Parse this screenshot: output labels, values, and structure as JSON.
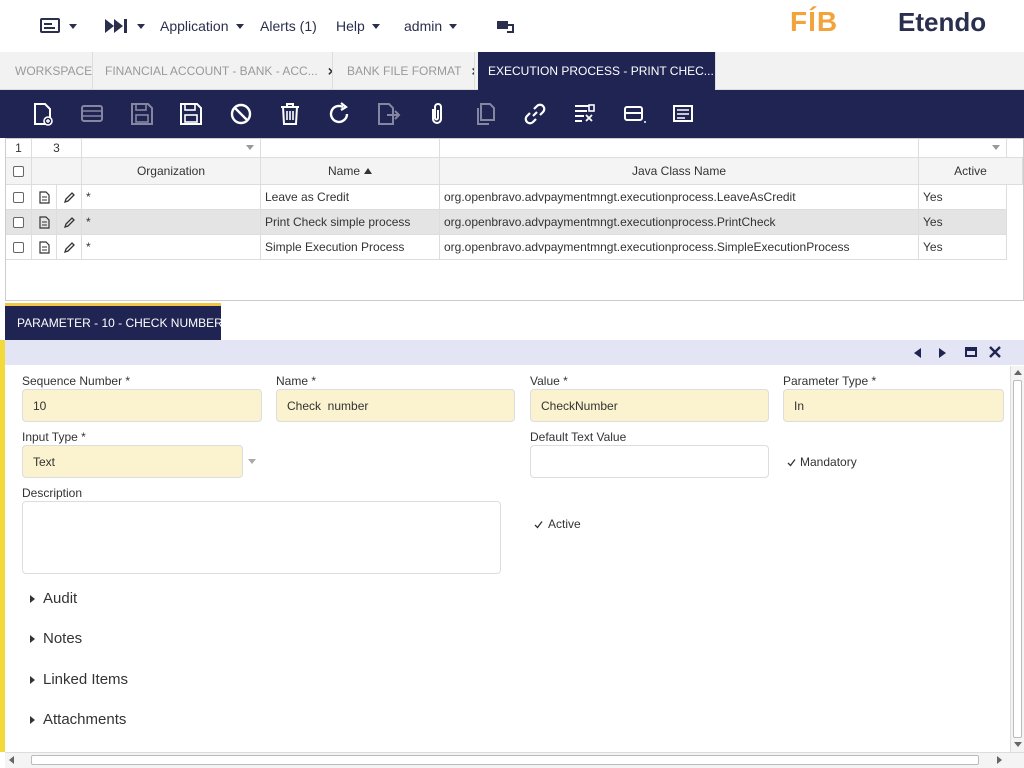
{
  "topbar": {
    "application": "Application",
    "alerts": "Alerts (1)",
    "help": "Help",
    "user": "admin",
    "logo_left": "FÍB",
    "logo_right": "Etendo"
  },
  "tabs": [
    {
      "label": "WORKSPACE"
    },
    {
      "label": "FINANCIAL ACCOUNT - BANK - ACC...",
      "close": "×"
    },
    {
      "label": "BANK FILE FORMAT",
      "close": "×"
    },
    {
      "label": "EXECUTION PROCESS - PRINT CHEC...",
      "close": "×"
    }
  ],
  "toolbar_icons": [
    "new-document-icon",
    "new-row-icon",
    "save-icon",
    "save-close-icon",
    "undo-icon",
    "delete-icon",
    "refresh-icon",
    "export-icon",
    "attachment-icon",
    "clone-icon",
    "link-icon",
    "filter-icon",
    "form-view-icon",
    "notes-icon"
  ],
  "grid": {
    "counter_left": "1",
    "counter_right": "3",
    "columns": {
      "organization": "Organization",
      "name": "Name",
      "java_class": "Java Class Name",
      "active": "Active"
    },
    "rows": [
      {
        "org": "*",
        "name": "Leave as Credit",
        "java": "org.openbravo.advpaymentmngt.executionprocess.LeaveAsCredit",
        "active": "Yes"
      },
      {
        "org": "*",
        "name": "Print Check simple process",
        "java": "org.openbravo.advpaymentmngt.executionprocess.PrintCheck",
        "active": "Yes"
      },
      {
        "org": "*",
        "name": "Simple Execution Process",
        "java": "org.openbravo.advpaymentmngt.executionprocess.SimpleExecutionProcess",
        "active": "Yes"
      }
    ]
  },
  "subtab": {
    "label": "PARAMETER - 10 - CHECK  NUMBER..."
  },
  "form": {
    "sequence_label": "Sequence Number *",
    "sequence_value": "10",
    "name_label": "Name *",
    "name_value": "Check  number",
    "value_label": "Value *",
    "value_value": "CheckNumber",
    "param_type_label": "Parameter Type *",
    "param_type_value": "In",
    "input_type_label": "Input Type *",
    "input_type_value": "Text",
    "default_text_label": "Default Text Value",
    "default_text_value": "",
    "mandatory_label": "Mandatory",
    "description_label": "Description",
    "active_label": "Active"
  },
  "sections": [
    "Audit",
    "Notes",
    "Linked Items",
    "Attachments"
  ],
  "colors": {
    "navy": "#202452",
    "highlight": "#f4d93a",
    "field": "#fbf2cf",
    "brand_orange": "#f2a33a"
  }
}
